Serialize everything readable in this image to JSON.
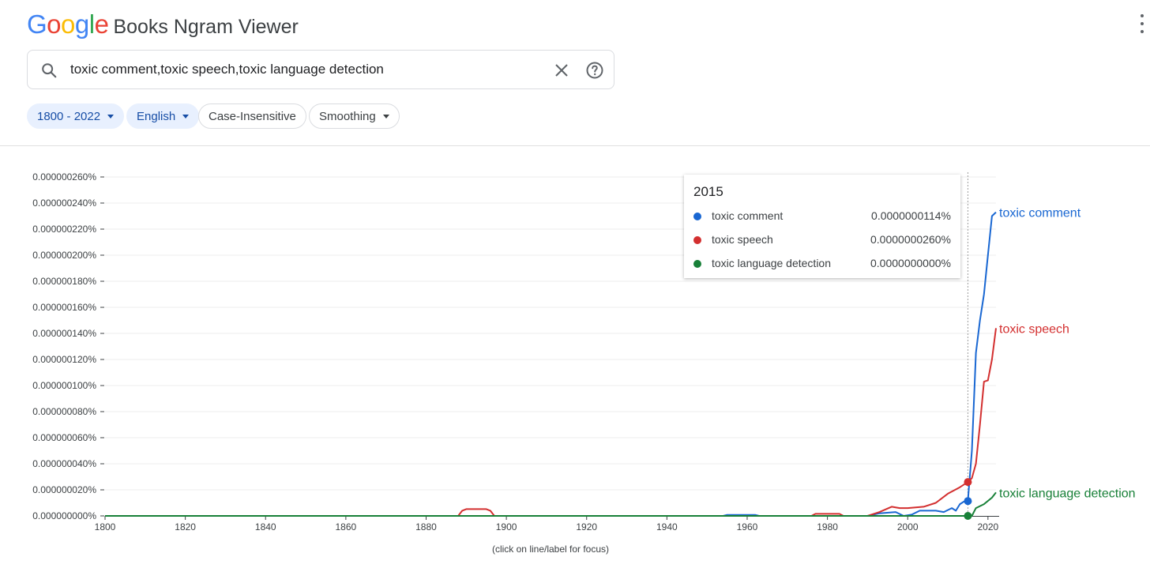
{
  "header": {
    "logo_letters": [
      {
        "ch": "G",
        "color": "#4285F4"
      },
      {
        "ch": "o",
        "color": "#EA4335"
      },
      {
        "ch": "o",
        "color": "#FBBC05"
      },
      {
        "ch": "g",
        "color": "#4285F4"
      },
      {
        "ch": "l",
        "color": "#34A853"
      },
      {
        "ch": "e",
        "color": "#EA4335"
      }
    ],
    "title": "Books Ngram Viewer",
    "menu_icon": "more-vert-icon"
  },
  "search": {
    "value": "toxic comment,toxic speech,toxic language detection",
    "search_icon": "search-icon",
    "clear_icon": "close-icon",
    "help_icon": "help-icon"
  },
  "filters": {
    "year_range": "1800 - 2022",
    "corpus": "English",
    "case": "Case-Insensitive",
    "smoothing": "Smoothing"
  },
  "tooltip": {
    "year": "2015",
    "rows": [
      {
        "name": "toxic comment",
        "value": "0.0000000114%",
        "color": "#1967d2"
      },
      {
        "name": "toxic speech",
        "value": "0.0000000260%",
        "color": "#d32f2f"
      },
      {
        "name": "toxic language detection",
        "value": "0.0000000000%",
        "color": "#188038"
      }
    ]
  },
  "footnote": "(click on line/label for focus)",
  "chart_data": {
    "type": "line",
    "x_range": [
      1800,
      2022
    ],
    "x_ticks": [
      1800,
      1820,
      1840,
      1860,
      1880,
      1900,
      1920,
      1940,
      1960,
      1980,
      2000,
      2020
    ],
    "y_range": [
      0,
      2.6e-07
    ],
    "y_ticks": [
      "0.000000000%",
      "0.000000020%",
      "0.000000040%",
      "0.000000060%",
      "0.000000080%",
      "0.000000100%",
      "0.000000120%",
      "0.000000140%",
      "0.000000160%",
      "0.000000180%",
      "0.000000200%",
      "0.000000220%",
      "0.000000240%",
      "0.000000260%"
    ],
    "focus_year": 2015,
    "series": [
      {
        "name": "toxic comment",
        "color": "#1967d2",
        "points": [
          [
            1800,
            0
          ],
          [
            1954,
            0
          ],
          [
            1955,
            8e-10
          ],
          [
            1962,
            8e-10
          ],
          [
            1963,
            0
          ],
          [
            1990,
            0
          ],
          [
            1993,
            2e-09
          ],
          [
            1997,
            3e-09
          ],
          [
            1999,
            0
          ],
          [
            2001,
            1e-09
          ],
          [
            2003,
            4e-09
          ],
          [
            2007,
            4e-09
          ],
          [
            2009,
            3e-09
          ],
          [
            2011,
            6e-09
          ],
          [
            2012,
            4e-09
          ],
          [
            2013,
            9e-09
          ],
          [
            2014,
            1.1e-08
          ],
          [
            2015,
            1.14e-08
          ],
          [
            2016,
            5e-08
          ],
          [
            2017,
            1.25e-07
          ],
          [
            2018,
            1.5e-07
          ],
          [
            2019,
            1.7e-07
          ],
          [
            2020,
            2e-07
          ],
          [
            2021,
            2.3e-07
          ],
          [
            2022,
            2.33e-07
          ]
        ]
      },
      {
        "name": "toxic speech",
        "color": "#d32f2f",
        "points": [
          [
            1800,
            0
          ],
          [
            1888,
            0
          ],
          [
            1889,
            4e-09
          ],
          [
            1890,
            5.2e-09
          ],
          [
            1895,
            5.2e-09
          ],
          [
            1896,
            4e-09
          ],
          [
            1897,
            0
          ],
          [
            1976,
            0
          ],
          [
            1977,
            1.6e-09
          ],
          [
            1983,
            1.6e-09
          ],
          [
            1984,
            0
          ],
          [
            1990,
            0
          ],
          [
            1993,
            3e-09
          ],
          [
            1996,
            7e-09
          ],
          [
            1998,
            6e-09
          ],
          [
            2000,
            6e-09
          ],
          [
            2004,
            7e-09
          ],
          [
            2007,
            1e-08
          ],
          [
            2010,
            1.7e-08
          ],
          [
            2013,
            2.2e-08
          ],
          [
            2015,
            2.6e-08
          ],
          [
            2016,
            2.9e-08
          ],
          [
            2017,
            4e-08
          ],
          [
            2018,
            7e-08
          ],
          [
            2019,
            1.03e-07
          ],
          [
            2020,
            1.04e-07
          ],
          [
            2021,
            1.2e-07
          ],
          [
            2022,
            1.44e-07
          ]
        ]
      },
      {
        "name": "toxic language detection",
        "color": "#188038",
        "points": [
          [
            1800,
            0
          ],
          [
            2015,
            0
          ],
          [
            2016,
            0
          ],
          [
            2017,
            6e-09
          ],
          [
            2019,
            9e-09
          ],
          [
            2021,
            1.4e-08
          ],
          [
            2022,
            1.8e-08
          ]
        ]
      }
    ]
  }
}
